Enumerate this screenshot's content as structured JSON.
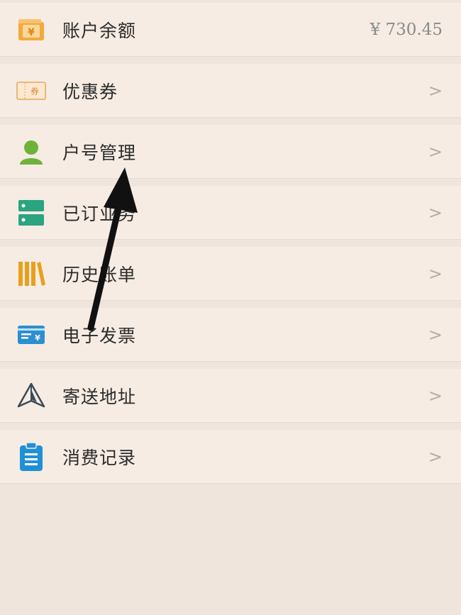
{
  "menu": {
    "items": [
      {
        "label": "账户余额",
        "value": "¥ 730.45",
        "icon": "yuan-wallet-icon"
      },
      {
        "label": "优惠券",
        "chevron": ">",
        "icon": "coupon-icon"
      },
      {
        "label": "户号管理",
        "chevron": ">",
        "icon": "user-icon"
      },
      {
        "label": "已订业务",
        "chevron": ">",
        "icon": "server-icon"
      },
      {
        "label": "历史账单",
        "chevron": ">",
        "icon": "books-icon"
      },
      {
        "label": "电子发票",
        "chevron": ">",
        "icon": "invoice-icon"
      },
      {
        "label": "寄送地址",
        "chevron": ">",
        "icon": "paper-plane-icon"
      },
      {
        "label": "消费记录",
        "chevron": ">",
        "icon": "clipboard-icon"
      }
    ],
    "coupon_icon_text": "券",
    "yuan_icon_text": "¥"
  },
  "colors": {
    "page_bg": "#efe5dc",
    "row_bg": "#f6ece3",
    "wallet_orange": "#f3a93b",
    "user_green": "#6fb23a",
    "server_green": "#2aa580",
    "books_orange": "#e8a01c",
    "invoice_blue": "#2b8fd0",
    "plane_dark": "#3d4a57",
    "clipboard_blue": "#1f90d6",
    "arrow_black": "#111111"
  }
}
